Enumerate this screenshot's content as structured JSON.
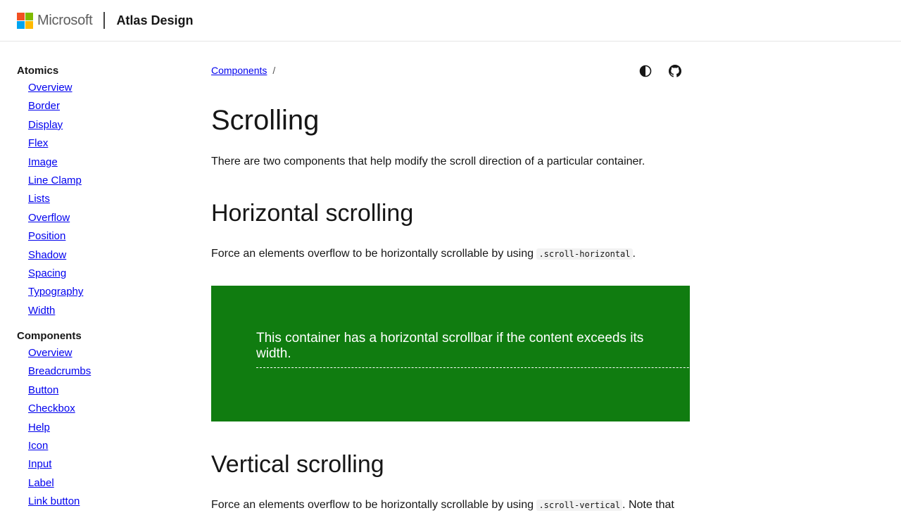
{
  "header": {
    "brand": "Microsoft",
    "product": "Atlas Design",
    "logo_colors": [
      "#f25022",
      "#7fba00",
      "#00a4ef",
      "#ffb900"
    ]
  },
  "sidebar": {
    "groups": [
      {
        "title": "Atomics",
        "items": [
          "Overview",
          "Border",
          "Display",
          "Flex",
          "Image",
          "Line Clamp",
          "Lists",
          "Overflow",
          "Position",
          "Shadow",
          "Spacing",
          "Typography",
          "Width"
        ]
      },
      {
        "title": "Components",
        "items": [
          "Overview",
          "Breadcrumbs",
          "Button",
          "Checkbox",
          "Help",
          "Icon",
          "Input",
          "Label",
          "Link button"
        ]
      }
    ]
  },
  "main": {
    "breadcrumb": {
      "link": "Components",
      "separator": "/"
    },
    "icons": [
      "theme-toggle-icon",
      "github-icon"
    ],
    "title": "Scrolling",
    "intro": "There are two components that help modify the scroll direction of a particular container.",
    "h_horizontal": "Horizontal scrolling",
    "p_horizontal_pre": "Force an elements overflow to be horizontally scrollable by using ",
    "p_horizontal_code": ".scroll-horizontal",
    "p_horizontal_post": ".",
    "demo_text": "This container has a horizontal scrollbar if the content exceeds its width.",
    "demo_color": "#107c10",
    "h_vertical": "Vertical scrolling",
    "p_vertical_pre": "Force an elements overflow to be horizontally scrollable by using ",
    "p_vertical_code": ".scroll-vertical",
    "p_vertical_post": ". Note that"
  }
}
